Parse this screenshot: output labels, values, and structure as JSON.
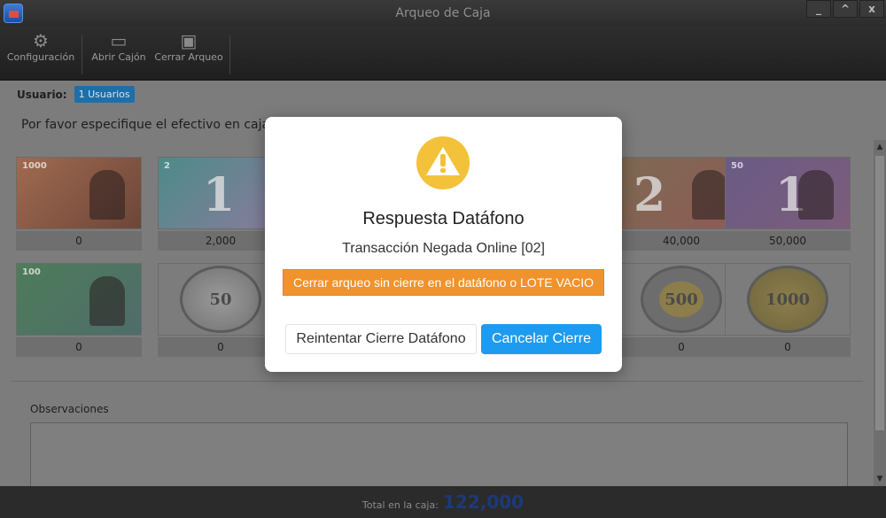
{
  "window": {
    "title": "Arqueo de Caja",
    "controls": [
      "_",
      "^",
      "x"
    ]
  },
  "toolbar": {
    "items": [
      {
        "label": "Configuración",
        "icon": "gear-icon"
      },
      {
        "label": "Abrir Cajón",
        "icon": "cash-drawer-icon"
      },
      {
        "label": "Cerrar Arqueo",
        "icon": "floppy-disk-icon"
      }
    ]
  },
  "user": {
    "label": "Usuario:",
    "badge": "1 Usuarios"
  },
  "instructions": "Por favor especifique el efectivo en caja",
  "denominations": [
    {
      "name": "bill-1000",
      "printed": "1000",
      "value": "0",
      "kind": "bill"
    },
    {
      "name": "bill-2000",
      "printed": "2",
      "value": "2,000",
      "kind": "bill",
      "count": "1"
    },
    {
      "name": "bill-20000",
      "printed": "",
      "value": "",
      "kind": "bill-hidden"
    },
    {
      "name": "bill-unknown",
      "printed": "",
      "value": "",
      "kind": "bill-hidden"
    },
    {
      "name": "bill-20000b",
      "printed": "",
      "value": "40,000",
      "kind": "bill",
      "count": "2"
    },
    {
      "name": "bill-50000",
      "printed": "50",
      "value": "50,000",
      "kind": "bill",
      "count": "1"
    },
    {
      "name": "bill-100000",
      "printed": "100",
      "value": "0",
      "kind": "bill"
    },
    {
      "name": "coin-50",
      "printed": "50",
      "value": "0",
      "kind": "coin"
    },
    {
      "name": "coin-hidden-1",
      "printed": "",
      "value": "",
      "kind": "coin-hidden"
    },
    {
      "name": "coin-hidden-2",
      "printed": "",
      "value": "",
      "kind": "coin-hidden"
    },
    {
      "name": "coin-500",
      "printed": "500",
      "value": "0",
      "kind": "coin"
    },
    {
      "name": "coin-1000",
      "printed": "1000",
      "value": "0",
      "kind": "coin"
    }
  ],
  "observations": {
    "label": "Observaciones",
    "value": ""
  },
  "footer": {
    "total_label": "Total en la caja:",
    "total_value": "122,000"
  },
  "modal": {
    "title": "Respuesta Datáfono",
    "message": "Transacción Negada Online [02]",
    "close_without_label": "Cerrar arqueo sin cierre en el datáfono o LOTE VACIO",
    "retry_label": "Reintentar Cierre Datáfono",
    "cancel_label": "Cancelar Cierre",
    "warning_color": "#f3c23a",
    "primary_color": "#1d9bf0",
    "orange_color": "#f0932c"
  }
}
